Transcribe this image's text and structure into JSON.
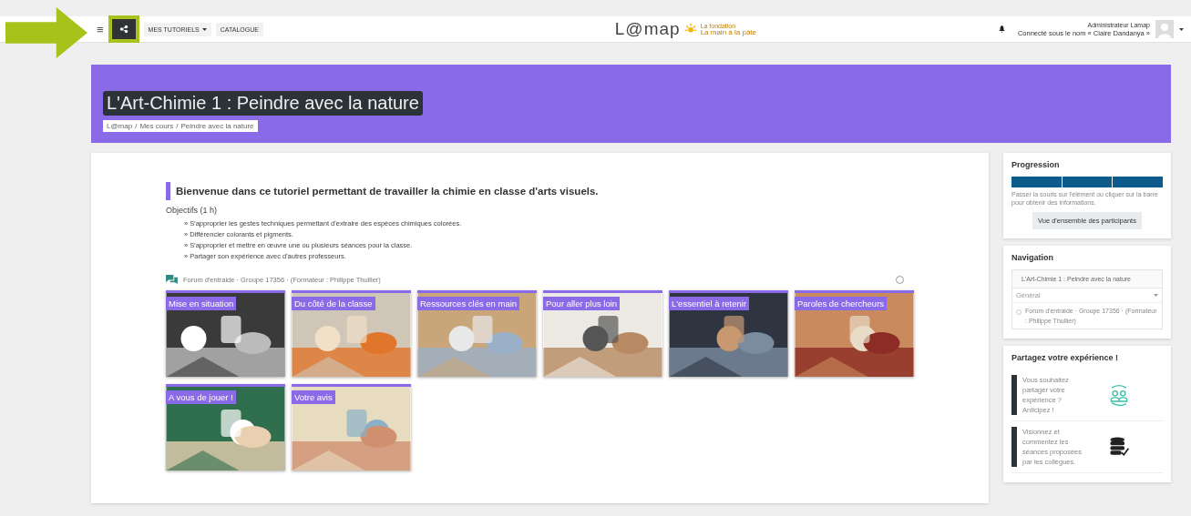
{
  "navbar": {
    "menu_icon": "≡",
    "highlighted_button": {
      "highlighted": true
    },
    "menus": [
      {
        "label": "MES TUTORIELS",
        "dropdown": true
      },
      {
        "label": "CATALOGUE",
        "dropdown": false
      }
    ],
    "logo": {
      "text": "L@map",
      "tagline_small": "La fondation",
      "tagline": "La main à la pâte"
    },
    "user": {
      "name": "Administrateur Lamap",
      "connected_as": "Connecté sous le nom « Claire Dandanya »"
    }
  },
  "header": {
    "title": "L'Art-Chimie 1 : Peindre avec la nature",
    "breadcrumb": [
      "L@map",
      "Mes cours",
      "Peindre avec la nature"
    ],
    "breadcrumb_separator": "/"
  },
  "course": {
    "intro": "Bienvenue dans ce tutoriel permettant de travailler la chimie en classe d'arts visuels.",
    "objectives_title": "Objectifs (1 h)",
    "objectives": [
      "» S'approprier les gestes techniques permettant d'extraire des espèces chimiques colorées.",
      "» Différencier colorants et pigments.",
      "» S'approprier et mettre en œuvre une ou plusieurs séances pour la classe.",
      "» Partager son expérience avec d'autres professeurs."
    ],
    "forum": {
      "label": "Forum d'entraide · Groupe 17356 · (Formateur : Philippe Thullier)",
      "completed": false
    },
    "tiles": [
      {
        "label": "Mise en situation",
        "kind": "picture"
      },
      {
        "label": "Du côté de la classe",
        "kind": "picture"
      },
      {
        "label": "Ressources clés en main",
        "kind": "picture"
      },
      {
        "label": "Pour aller plus loin",
        "kind": "picture"
      },
      {
        "label": "L'essentiel à retenir",
        "kind": "picture"
      },
      {
        "label": "Paroles de chercheurs",
        "kind": "picture"
      },
      {
        "label": "A vous de jouer !",
        "kind": "picture"
      },
      {
        "label": "Votre avis",
        "kind": "picture"
      }
    ]
  },
  "sidebar": {
    "progression": {
      "title": "Progression",
      "segments": [
        {
          "completed": true
        },
        {
          "completed": true
        },
        {
          "completed": true
        }
      ],
      "hint": "Passer la souris sur l'élément ou cliquer sur la barre pour obtenir des informations.",
      "button": "Vue d'ensemble des participants"
    },
    "navigation": {
      "title": "Navigation",
      "course": "L'Art-Chimie 1 : Peindre avec la nature",
      "section": "Général",
      "items": [
        "Forum d'entraide · Groupe 17356 · (Formateur : Philippe Thullier)"
      ]
    },
    "share": {
      "title": "Partagez votre expérience !",
      "items": [
        {
          "text": "Vous souhaitez partager votre expérience ? Anticipez !",
          "kind": "people"
        },
        {
          "text": "Visionnez et commentez les séances proposées par les collègues.",
          "kind": "database"
        }
      ]
    }
  }
}
